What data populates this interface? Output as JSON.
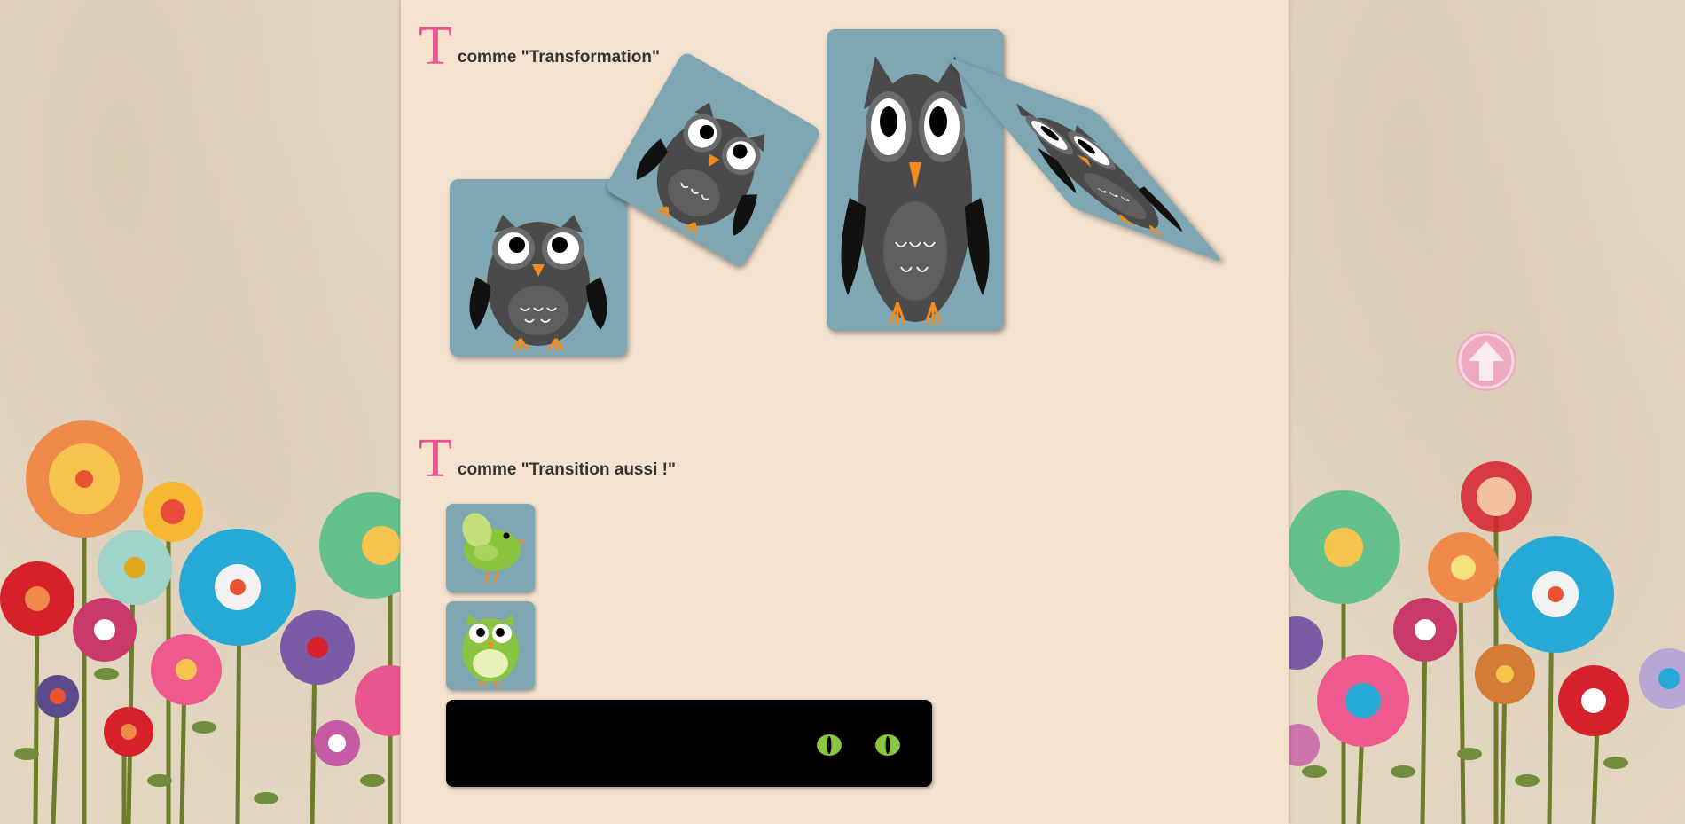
{
  "sections": [
    {
      "letter": "T",
      "text": "comme \"Transformation\""
    },
    {
      "letter": "T",
      "text": "comme \"Transition aussi !\""
    }
  ],
  "colors": {
    "accent_letter": "#e8568f",
    "panel": "#f4e1ce",
    "card": "#7fa6b3",
    "scroll_button": "#f2a6c2"
  },
  "icons": {
    "scroll_top": "arrow-up-icon",
    "owl": "owl-icon",
    "bird": "bird-icon",
    "cat_eyes": "cat-eyes-icon"
  }
}
